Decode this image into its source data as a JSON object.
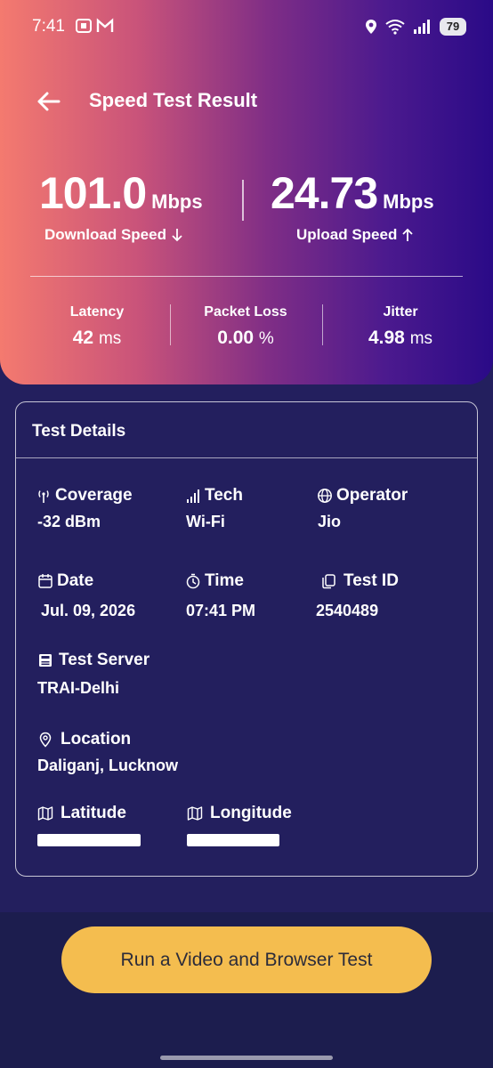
{
  "status_bar": {
    "time": "7:41",
    "battery": "79"
  },
  "header": {
    "title": "Speed Test Result"
  },
  "speeds": {
    "download": {
      "value": "101.0",
      "unit": "Mbps",
      "label": "Download Speed"
    },
    "upload": {
      "value": "24.73",
      "unit": "Mbps",
      "label": "Upload Speed"
    }
  },
  "metrics": [
    {
      "label": "Latency",
      "value": "42",
      "unit": "ms"
    },
    {
      "label": "Packet Loss",
      "value": "0.00",
      "unit": "%"
    },
    {
      "label": "Jitter",
      "value": "4.98",
      "unit": "ms"
    }
  ],
  "details": {
    "title": "Test Details",
    "coverage": {
      "label": "Coverage",
      "value": "-32 dBm"
    },
    "tech": {
      "label": "Tech",
      "value": "Wi-Fi"
    },
    "operator": {
      "label": "Operator",
      "value": "Jio"
    },
    "date": {
      "label": "Date",
      "value": "Jul. 09, 2026"
    },
    "time": {
      "label": "Time",
      "value": "07:41 PM"
    },
    "test_id": {
      "label": "Test ID",
      "value": "2540489"
    },
    "server": {
      "label": "Test Server",
      "value": "TRAI-Delhi"
    },
    "location": {
      "label": "Location",
      "value": "Daliganj, Lucknow"
    },
    "latitude": {
      "label": "Latitude"
    },
    "longitude": {
      "label": "Longitude"
    }
  },
  "cta": {
    "label": "Run a Video and Browser Test"
  },
  "colors": {
    "gradient_start": "#f47a6f",
    "gradient_end": "#2a0a87",
    "background": "#231f5e",
    "cta": "#f4bd4f"
  }
}
